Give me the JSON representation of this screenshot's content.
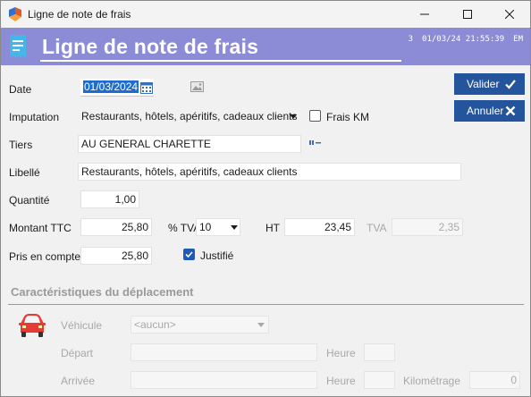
{
  "window": {
    "title": "Ligne de note de frais"
  },
  "header": {
    "title": "Ligne de note de frais",
    "meta_number": "3",
    "meta_datetime": "01/03/24 21:55:39",
    "meta_user": "EM"
  },
  "form": {
    "date_label": "Date",
    "date_value": "01/03/2024",
    "imputation_label": "Imputation",
    "imputation_value": "Restaurants, hôtels, apéritifs, cadeaux clients",
    "frais_km_label": "Frais KM",
    "tiers_label": "Tiers",
    "tiers_value": "AU GENERAL CHARETTE",
    "libelle_label": "Libellé",
    "libelle_value": "Restaurants, hôtels, apéritifs, cadeaux clients",
    "quantite_label": "Quantité",
    "quantite_value": "1,00",
    "montant_ttc_label": "Montant TTC",
    "montant_ttc_value": "25,80",
    "tva_pct_label": "% TVA",
    "tva_pct_value": "10",
    "ht_label": "HT",
    "ht_value": "23,45",
    "tva_label": "TVA",
    "tva_value": "2,35",
    "pris_en_compte_label": "Pris en compte",
    "pris_en_compte_value": "25,80",
    "justifie_label": "Justifié",
    "justifie_checked": true,
    "frais_km_checked": false
  },
  "buttons": {
    "valider": "Valider",
    "annuler": "Annuler"
  },
  "deplacement": {
    "section_title": "Caractéristiques du déplacement",
    "vehicule_label": "Véhicule",
    "vehicule_value": "<aucun>",
    "depart_label": "Départ",
    "arrivee_label": "Arrivée",
    "heure_label": "Heure",
    "heure2_label": "Heure",
    "kilometrage_label": "Kilométrage",
    "kilometrage_value": "0"
  },
  "colors": {
    "header_band": "#8c8cd6",
    "button": "#24549c",
    "date_highlight": "#1e6cd0"
  },
  "icons": [
    "app-icon",
    "receipt-icon",
    "calendar-icon",
    "image-icon",
    "lookup-icon",
    "check-icon",
    "x-icon",
    "car-icon",
    "minimize-icon",
    "maximize-icon",
    "close-icon"
  ]
}
